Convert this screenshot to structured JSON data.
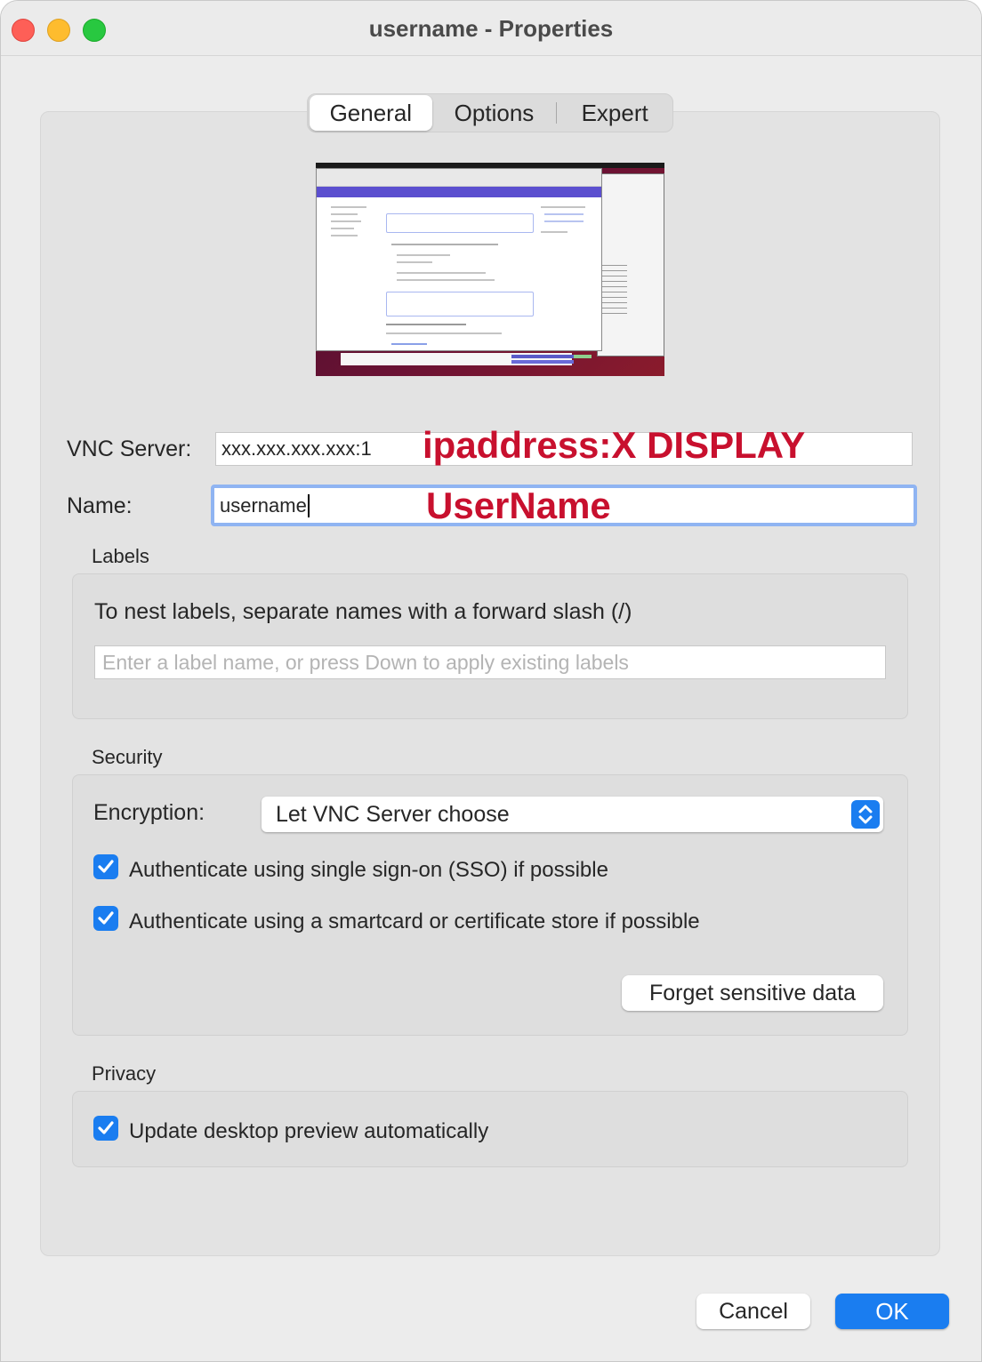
{
  "window": {
    "title": "username - Properties"
  },
  "tabs": [
    {
      "label": "General",
      "active": true
    },
    {
      "label": "Options",
      "active": false
    },
    {
      "label": "Expert",
      "active": false
    }
  ],
  "form": {
    "vnc_server_label": "VNC Server:",
    "vnc_server_value": "xxx.xxx.xxx.xxx:1",
    "name_label": "Name:",
    "name_value": "username"
  },
  "annotations": {
    "server_note": "ipaddress:X DISPLAY",
    "name_note": "UserName"
  },
  "labels_section": {
    "title": "Labels",
    "hint": "To nest labels, separate names with a forward slash (/)",
    "placeholder": "Enter a label name, or press Down to apply existing labels"
  },
  "security": {
    "title": "Security",
    "encryption_label": "Encryption:",
    "encryption_value": "Let VNC Server choose",
    "sso_label": "Authenticate using single sign-on (SSO) if possible",
    "sso_checked": true,
    "smartcard_label": "Authenticate using a smartcard or certificate store if possible",
    "smartcard_checked": true,
    "forget_button": "Forget sensitive data"
  },
  "privacy": {
    "title": "Privacy",
    "preview_label": "Update desktop preview automatically",
    "preview_checked": true
  },
  "footer": {
    "cancel": "Cancel",
    "ok": "OK"
  },
  "colors": {
    "accent": "#1a7df0",
    "annotation": "#c8102e"
  }
}
